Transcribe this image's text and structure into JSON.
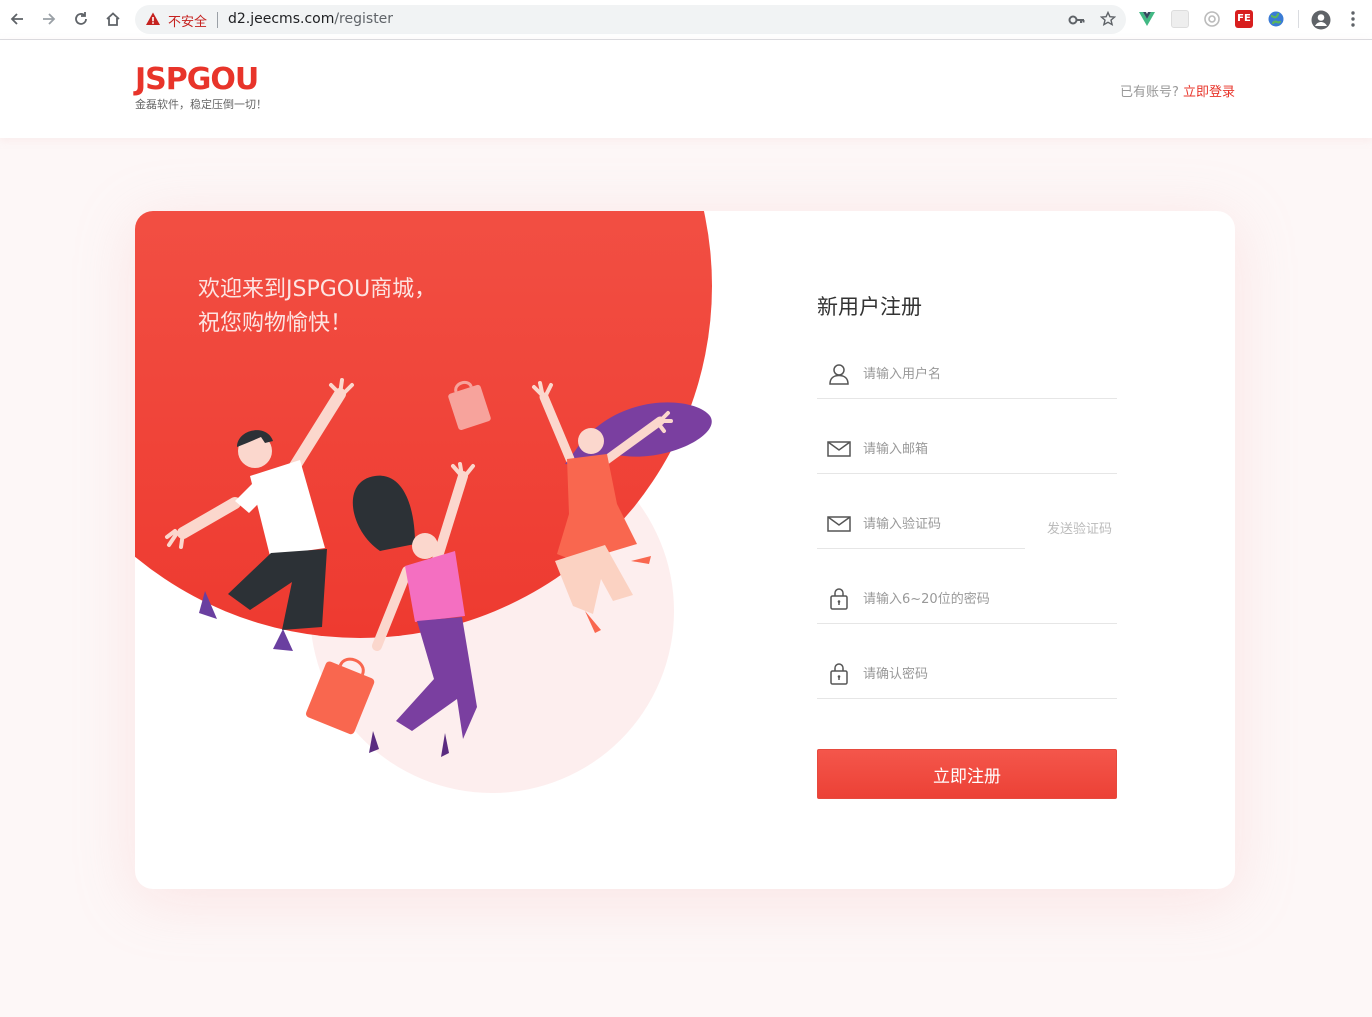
{
  "browser": {
    "insecure_label": "不安全",
    "url_host": "d2.jeecms.com",
    "url_path": "/register",
    "colors": {
      "warning": "#c5221f"
    }
  },
  "header": {
    "logo_text": "JSPGOU",
    "slogan": "金磊软件，稳定压倒一切！",
    "have_account": "已有账号?",
    "login_link": "立即登录"
  },
  "hero": {
    "welcome_line1": "欢迎来到JSPGOU商城，",
    "welcome_line2": "祝您购物愉快！"
  },
  "form": {
    "title": "新用户注册",
    "fields": [
      {
        "icon": "user-icon",
        "placeholder": "请输入用户名"
      },
      {
        "icon": "mail-icon",
        "placeholder": "请输入邮箱"
      },
      {
        "icon": "mail-icon",
        "placeholder": "请输入验证码"
      },
      {
        "icon": "lock-icon",
        "placeholder": "请输入6~20位的密码"
      },
      {
        "icon": "lock-icon",
        "placeholder": "请确认密码"
      }
    ],
    "send_code": "发送验证码",
    "submit": "立即注册"
  },
  "colors": {
    "brand": "#e8342a",
    "button": "#f04a3f",
    "page_bg": "#fdf7f7"
  }
}
